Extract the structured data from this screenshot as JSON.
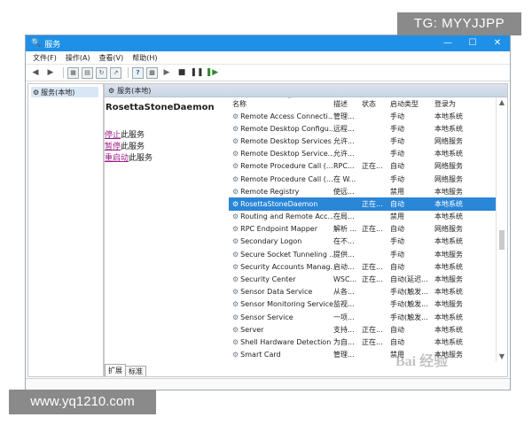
{
  "overlay": {
    "top_tag": "TG: MYYJJPP",
    "bottom_url": "www.yq1210.com",
    "bottom_right_mark": "Bai 经验"
  },
  "window": {
    "title": "服务",
    "controls": {
      "minimize": "—",
      "maximize": "☐",
      "close": "✕"
    }
  },
  "menu": [
    "文件(F)",
    "操作(A)",
    "查看(V)",
    "帮助(H)"
  ],
  "toolbar_icons": [
    "back-arrow-icon",
    "forward-arrow-icon",
    "console-tree-icon",
    "show-scope-icon",
    "refresh-icon",
    "export-list-icon",
    "help-icon",
    "properties-icon",
    "play-icon",
    "stop-icon",
    "pause-icon",
    "restart-icon"
  ],
  "tree": {
    "item": "服务(本地)"
  },
  "main_header": "服务(本地)",
  "detail": {
    "service_name": "RosettaStoneDaemon",
    "actions": [
      {
        "link": "停止",
        "rest": "此服务"
      },
      {
        "link": "暂停",
        "rest": "此服务"
      },
      {
        "link": "重启动",
        "rest": "此服务"
      }
    ]
  },
  "tabs": [
    "扩展",
    "标准"
  ],
  "columns": {
    "name": "名称",
    "desc": "描述",
    "status": "状态",
    "startup": "启动类型",
    "logon": "登录为"
  },
  "rows": [
    {
      "name": "Remote Access Connecti...",
      "desc": "管理...",
      "status": "",
      "startup": "手动",
      "logon": "本地系统"
    },
    {
      "name": "Remote Desktop Configu...",
      "desc": "远程...",
      "status": "",
      "startup": "手动",
      "logon": "本地系统"
    },
    {
      "name": "Remote Desktop Services",
      "desc": "允许...",
      "status": "",
      "startup": "手动",
      "logon": "网络服务"
    },
    {
      "name": "Remote Desktop Service...",
      "desc": "允许...",
      "status": "",
      "startup": "手动",
      "logon": "本地系统"
    },
    {
      "name": "Remote Procedure Call (...",
      "desc": "RPC...",
      "status": "正在...",
      "startup": "自动",
      "logon": "网络服务"
    },
    {
      "name": "Remote Procedure Call (...",
      "desc": "在 W...",
      "status": "",
      "startup": "手动",
      "logon": "网络服务"
    },
    {
      "name": "Remote Registry",
      "desc": "使远...",
      "status": "",
      "startup": "禁用",
      "logon": "本地服务"
    },
    {
      "name": "RosettaStoneDaemon",
      "desc": "",
      "status": "正在...",
      "startup": "自动",
      "logon": "本地系统",
      "selected": true
    },
    {
      "name": "Routing and Remote Acc...",
      "desc": "在局...",
      "status": "",
      "startup": "禁用",
      "logon": "本地系统"
    },
    {
      "name": "RPC Endpoint Mapper",
      "desc": "解析 ...",
      "status": "正在...",
      "startup": "自动",
      "logon": "网络服务"
    },
    {
      "name": "Secondary Logon",
      "desc": "在不...",
      "status": "",
      "startup": "手动",
      "logon": "本地系统"
    },
    {
      "name": "Secure Socket Tunneling ...",
      "desc": "提供...",
      "status": "",
      "startup": "手动",
      "logon": "本地服务"
    },
    {
      "name": "Security Accounts Manag...",
      "desc": "启动...",
      "status": "正在...",
      "startup": "自动",
      "logon": "本地系统"
    },
    {
      "name": "Security Center",
      "desc": "WSC...",
      "status": "正在...",
      "startup": "自动(延迟...",
      "logon": "本地服务"
    },
    {
      "name": "Sensor Data Service",
      "desc": "从各...",
      "status": "",
      "startup": "手动(触发...",
      "logon": "本地系统"
    },
    {
      "name": "Sensor Monitoring Service",
      "desc": "监视...",
      "status": "",
      "startup": "手动(触发...",
      "logon": "本地服务"
    },
    {
      "name": "Sensor Service",
      "desc": "一项...",
      "status": "",
      "startup": "手动(触发...",
      "logon": "本地系统"
    },
    {
      "name": "Server",
      "desc": "支持...",
      "status": "正在...",
      "startup": "自动",
      "logon": "本地系统"
    },
    {
      "name": "Shell Hardware Detection",
      "desc": "为自...",
      "status": "正在...",
      "startup": "自动",
      "logon": "本地系统"
    },
    {
      "name": "Smart Card",
      "desc": "管理...",
      "status": "",
      "startup": "禁用",
      "logon": "本地服务"
    }
  ]
}
